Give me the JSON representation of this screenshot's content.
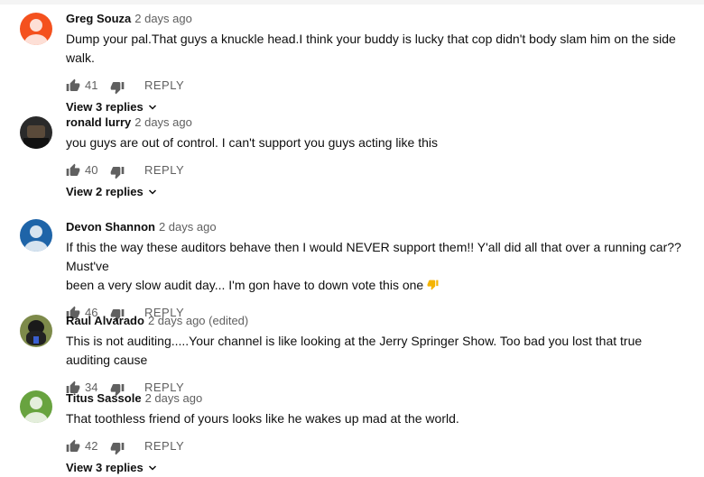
{
  "comments": [
    {
      "author": "Greg Souza",
      "time": "2 days ago",
      "text": "Dump your pal.That guys a knuckle head.I think your buddy is lucky that cop didn't body slam him on the side walk.",
      "likes": "41",
      "reply_label": "REPLY",
      "view_replies": "View 3 replies",
      "avatar_color": "#f4511e"
    },
    {
      "author": "ronald lurry",
      "time": "2 days ago",
      "text": "you guys are out of control. I can't support you guys acting like this",
      "likes": "40",
      "reply_label": "REPLY",
      "view_replies": "View 2 replies",
      "avatar_color": "#2a2a2a"
    },
    {
      "author": "Devon Shannon",
      "time": "2 days ago",
      "text_line1": "If this the way these auditors behave then I would NEVER support them!! Y'all did all that over a running car?? Must've",
      "text_line2": "been a very slow audit day... I'm gon have to down vote this one",
      "likes": "46",
      "reply_label": "REPLY",
      "avatar_color": "#1e64a8"
    },
    {
      "author": "Raul Alvarado",
      "time": "2 days ago (edited)",
      "text": "This is not auditing.....Your channel is like looking at the Jerry Springer Show. Too bad you lost that true auditing cause",
      "likes": "34",
      "reply_label": "REPLY",
      "avatar_color": "#7d8a4a"
    },
    {
      "author": "Titus Sassole",
      "time": "2 days ago",
      "text": "That toothless friend of yours looks like he wakes up mad at the world.",
      "likes": "42",
      "reply_label": "REPLY",
      "view_replies": "View 3 replies",
      "avatar_color": "#68a33f"
    }
  ],
  "icons": {
    "like": "thumbs-up-icon",
    "dislike": "thumbs-down-icon",
    "chevron": "chevron-down-icon",
    "emoji": "thumbs-down-emoji"
  },
  "colors": {
    "meta_text": "#606060",
    "body_text": "#0f0f0f"
  }
}
